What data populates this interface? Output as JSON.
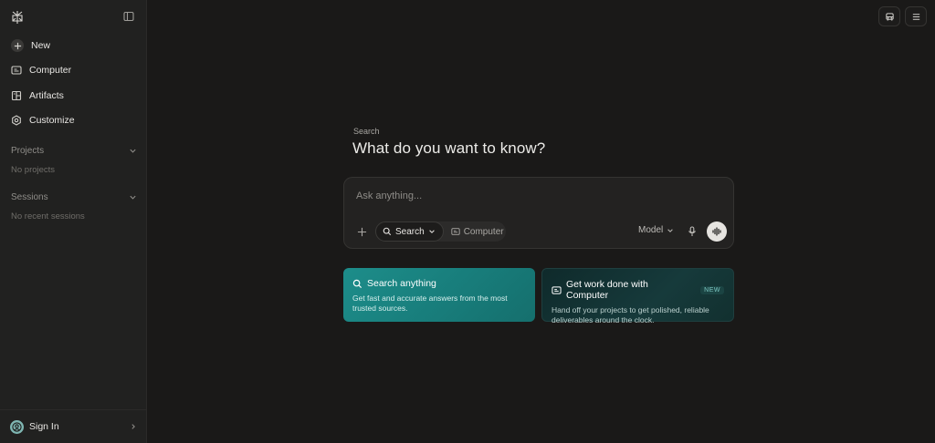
{
  "sidebar": {
    "nav": [
      {
        "label": "New",
        "icon": "plus-icon"
      },
      {
        "label": "Computer",
        "icon": "computer-icon"
      },
      {
        "label": "Artifacts",
        "icon": "artifacts-icon"
      },
      {
        "label": "Customize",
        "icon": "settings-icon"
      }
    ],
    "projects": {
      "title": "Projects",
      "empty": "No projects"
    },
    "sessions": {
      "title": "Sessions",
      "empty": "No recent sessions"
    },
    "sign_in": "Sign In"
  },
  "main": {
    "label": "Search",
    "title": "What do you want to know?",
    "input": {
      "placeholder": "Ask anything...",
      "value": ""
    },
    "modes": {
      "search": "Search",
      "computer": "Computer"
    },
    "model": "Model"
  },
  "cards": [
    {
      "title": "Search anything",
      "desc": "Get fast and accurate answers from the most trusted sources.",
      "badge": ""
    },
    {
      "title": "Get work done with Computer",
      "desc": "Hand off your projects to get polished, reliable deliverables around the clock.",
      "badge": "NEW"
    }
  ],
  "colors": {
    "accent": "#1d8d8a",
    "background": "#1a1918",
    "sidebar": "#212120"
  }
}
